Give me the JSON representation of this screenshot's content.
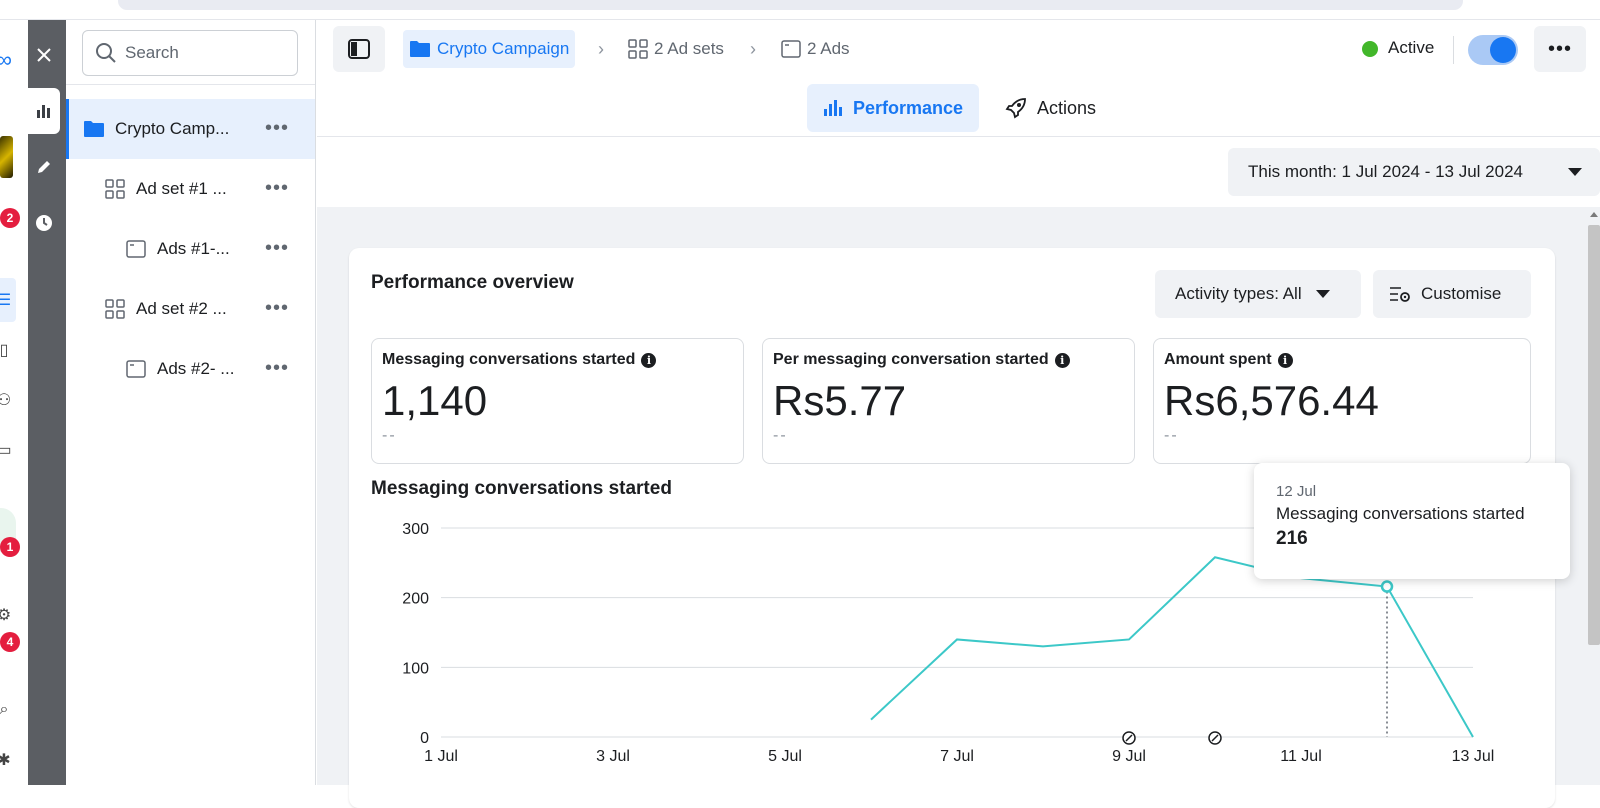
{
  "sidebar": {
    "search_placeholder": "Search",
    "items": [
      {
        "label": "Crypto Camp...",
        "type": "campaign"
      },
      {
        "label": "Ad set #1 ...",
        "type": "adset"
      },
      {
        "label": "Ads #1-...",
        "type": "ad"
      },
      {
        "label": "Ad set #2 ...",
        "type": "adset"
      },
      {
        "label": "Ads #2- ...",
        "type": "ad"
      }
    ]
  },
  "rail": {
    "badges": [
      "2",
      "1",
      "4"
    ]
  },
  "breadcrumb": {
    "campaign": "Crypto Campaign",
    "adsets": "2 Ad sets",
    "ads": "2 Ads"
  },
  "status": {
    "label": "Active",
    "enabled": true
  },
  "tabs": [
    {
      "label": "Performance",
      "active": true
    },
    {
      "label": "Actions",
      "active": false
    }
  ],
  "date_range": "This month: 1 Jul 2024 - 13 Jul 2024",
  "overview": {
    "title": "Performance overview",
    "activity_filter": "Activity types: All",
    "customise": "Customise",
    "metrics": [
      {
        "label": "Messaging conversations started",
        "value": "1,140",
        "sub": "--"
      },
      {
        "label": "Per messaging conversation started",
        "value": "Rs5.77",
        "sub": "--"
      },
      {
        "label": "Amount spent",
        "value": "Rs6,576.44",
        "sub": "--"
      }
    ]
  },
  "chart_title": "Messaging conversations started",
  "tooltip": {
    "date": "12 Jul",
    "label": "Messaging conversations started",
    "value": "216"
  },
  "colors": {
    "accent": "#1877f2",
    "line": "#3cc8c8",
    "active_status": "#42b72a"
  },
  "chart_data": {
    "type": "line",
    "x": [
      "1 Jul",
      "2 Jul",
      "3 Jul",
      "4 Jul",
      "5 Jul",
      "6 Jul",
      "7 Jul",
      "8 Jul",
      "9 Jul",
      "10 Jul",
      "11 Jul",
      "12 Jul",
      "13 Jul"
    ],
    "xticks": [
      "1 Jul",
      "3 Jul",
      "5 Jul",
      "7 Jul",
      "9 Jul",
      "11 Jul",
      "13 Jul"
    ],
    "series": [
      {
        "values": [
          null,
          null,
          null,
          null,
          null,
          25,
          140,
          130,
          140,
          258,
          228,
          216,
          0
        ]
      }
    ],
    "ylim": [
      0,
      300
    ],
    "yticks": [
      0,
      100,
      200,
      300
    ],
    "highlight_index": 11,
    "grid": true
  }
}
